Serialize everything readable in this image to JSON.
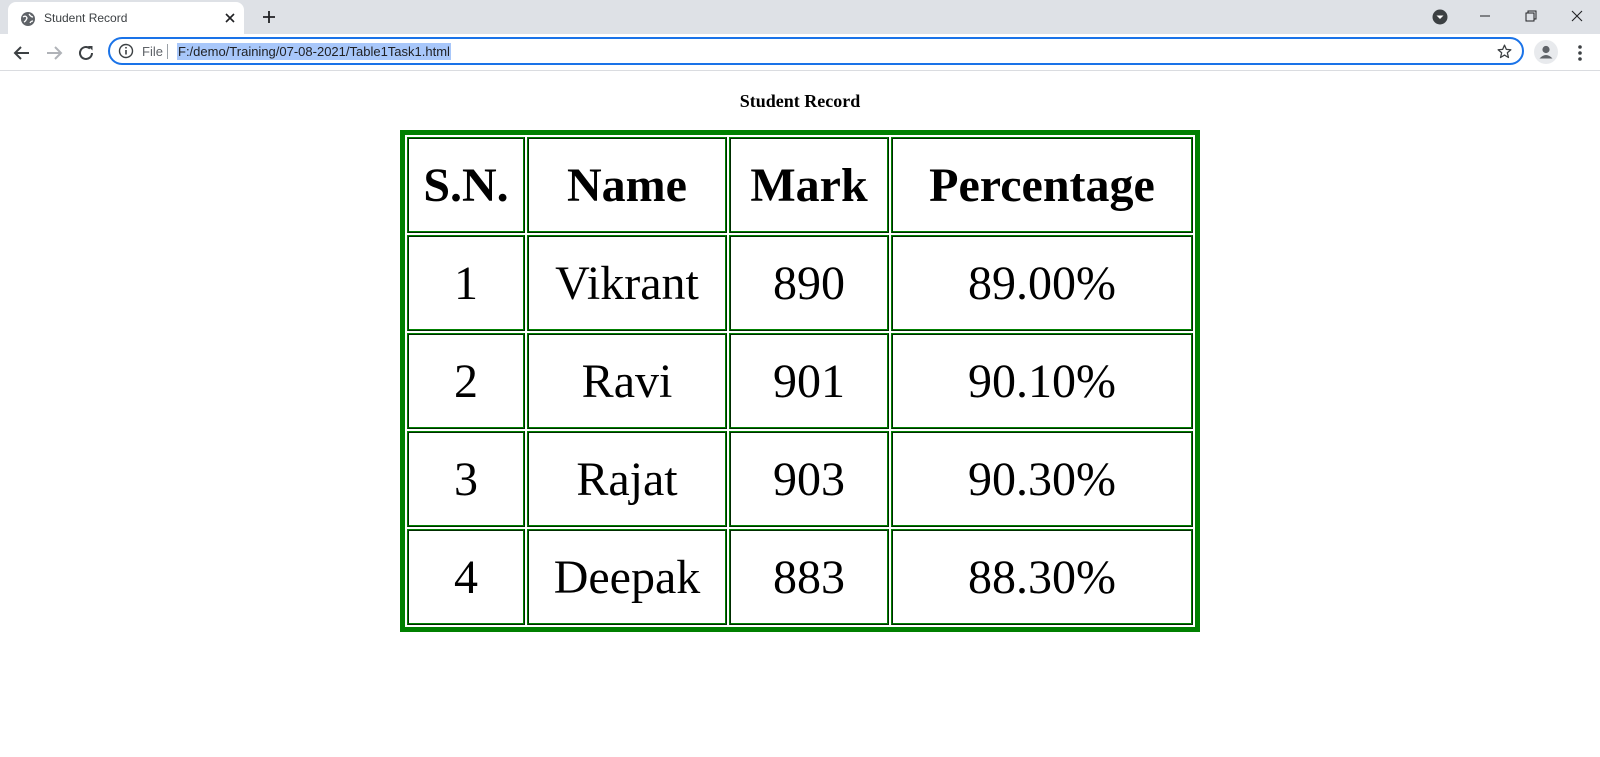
{
  "browser": {
    "tab": {
      "title": "Student Record"
    },
    "omnibox": {
      "scheme_label": "File",
      "url": "F:/demo/Training/07-08-2021/Table1Task1.html"
    }
  },
  "page": {
    "caption": "Student Record",
    "table": {
      "headers": [
        "S.N.",
        "Name",
        "Mark",
        "Percentage"
      ],
      "rows": [
        [
          "1",
          "Vikrant",
          "890",
          "89.00%"
        ],
        [
          "2",
          "Ravi",
          "901",
          "90.10%"
        ],
        [
          "3",
          "Rajat",
          "903",
          "90.30%"
        ],
        [
          "4",
          "Deepak",
          "883",
          "88.30%"
        ]
      ]
    }
  },
  "colors": {
    "table_border": "#008000",
    "tabstrip_bg": "#dee1e6",
    "omnibox_focus": "#1a73e8",
    "url_selection": "#a8c7fa"
  },
  "icons": [
    "globe-icon",
    "close-icon",
    "plus-icon",
    "back-arrow-icon",
    "forward-arrow-icon",
    "reload-icon",
    "info-icon",
    "star-icon",
    "profile-icon",
    "more-vert-icon",
    "minimize-icon",
    "restore-icon",
    "window-close-icon",
    "dropdown-icon"
  ]
}
